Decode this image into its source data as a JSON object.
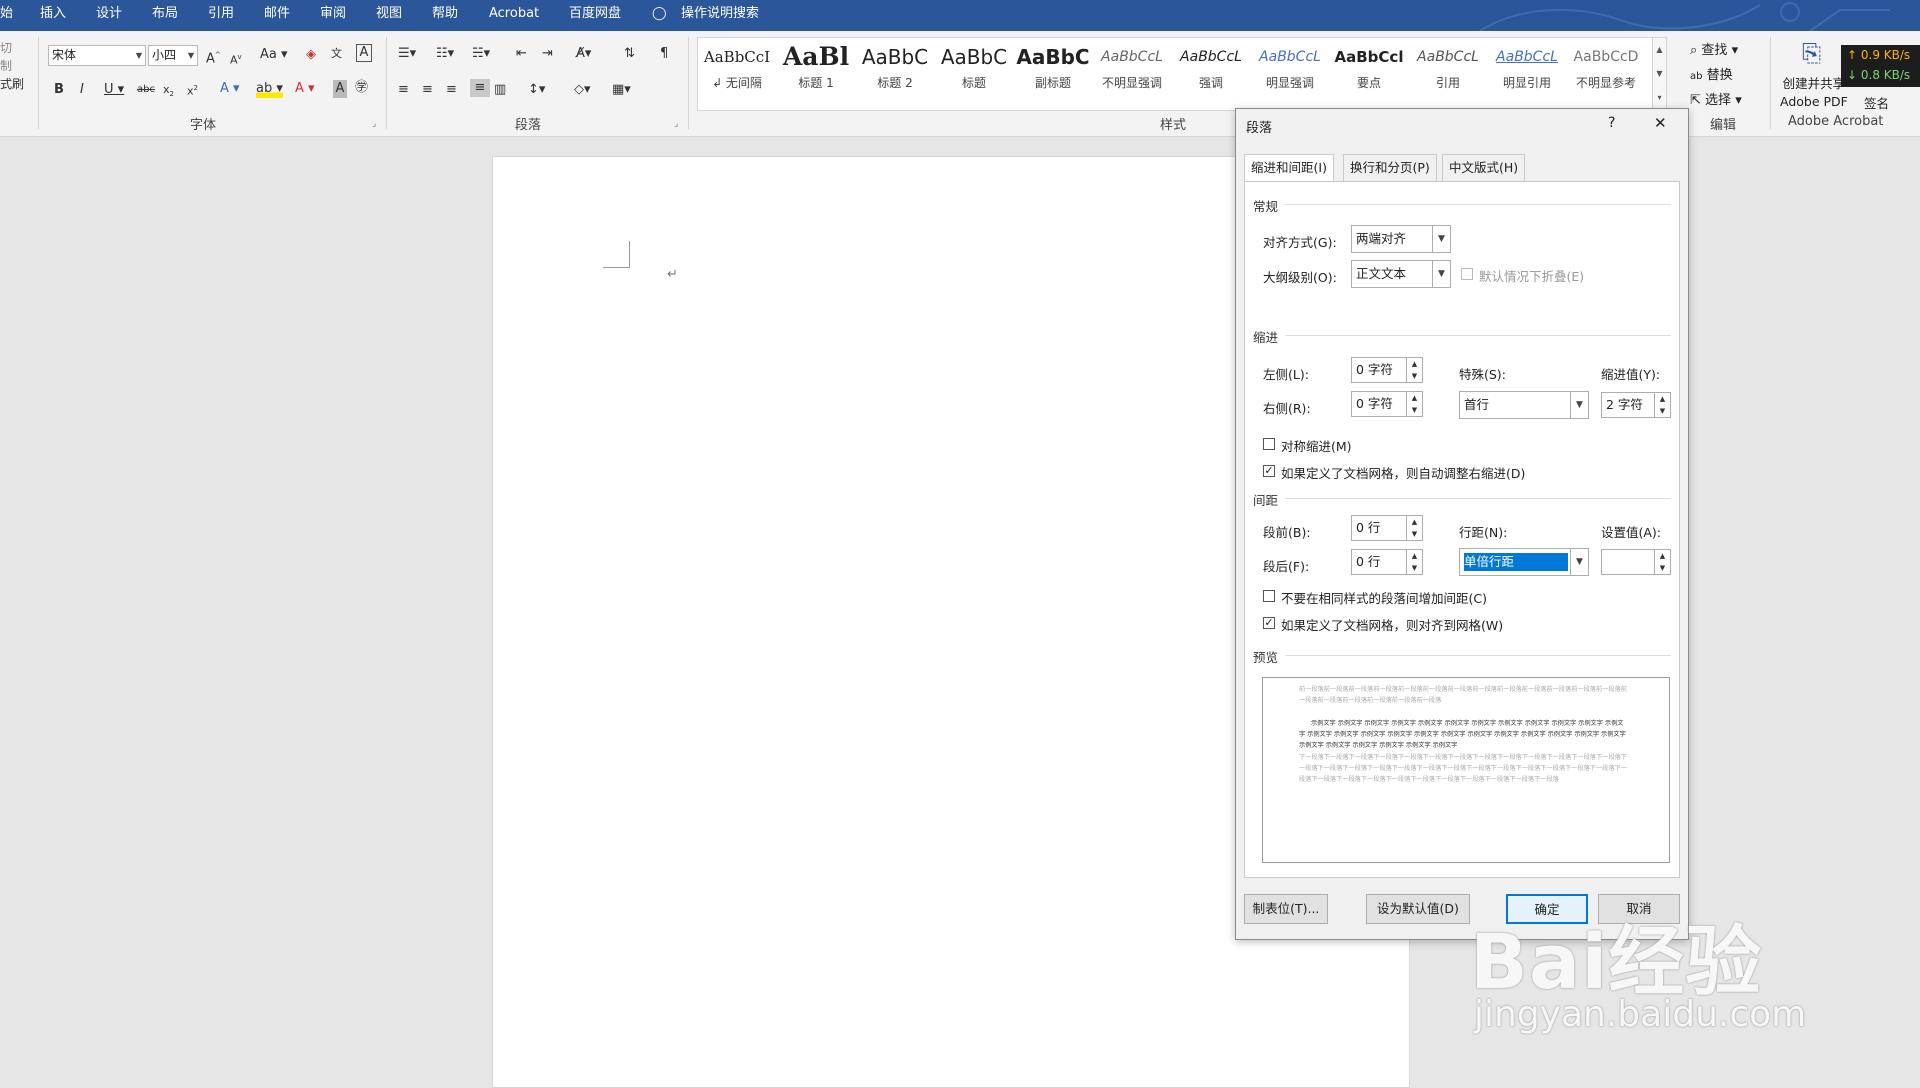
{
  "menu": {
    "items": [
      "插入",
      "设计",
      "布局",
      "引用",
      "邮件",
      "审阅",
      "视图",
      "帮助",
      "Acrobat",
      "百度网盘"
    ],
    "search_label": "操作说明搜索"
  },
  "clipboard_cut": {
    "lines": [
      "切",
      "制",
      "式刷"
    ]
  },
  "font": {
    "name": "宋体",
    "size": "小四",
    "group_label": "字体"
  },
  "paragraph_group": {
    "label": "段落"
  },
  "styles": {
    "group_label": "样式",
    "items": [
      {
        "preview": "AaBbCcI",
        "name": "↲ 无间隔"
      },
      {
        "preview": "AaBl",
        "name": "标题 1"
      },
      {
        "preview": "AaBbC",
        "name": "标题 2"
      },
      {
        "preview": "AaBbC",
        "name": "标题"
      },
      {
        "preview": "AaBbC",
        "name": "副标题"
      },
      {
        "preview": "AaBbCcL",
        "name": "不明显强调"
      },
      {
        "preview": "AaBbCcL",
        "name": "强调"
      },
      {
        "preview": "AaBbCcL",
        "name": "明显强调"
      },
      {
        "preview": "AaBbCcl",
        "name": "要点"
      },
      {
        "preview": "AaBbCcL",
        "name": "引用"
      },
      {
        "preview": "AaBbCcL",
        "name": "明显引用"
      },
      {
        "preview": "AaBbCcD",
        "name": "不明显参考"
      }
    ]
  },
  "editing": {
    "find": "查找",
    "replace": "替换",
    "select": "选择",
    "group_label": "编辑"
  },
  "acrobat": {
    "create_share": "创建并共享",
    "adobe_pdf": "Adobe PDF",
    "sign": "签名",
    "group_label": "Adobe Acrobat"
  },
  "network": {
    "up": "↑ 0.9 KB/s",
    "down": "↓ 0.8 KB/s"
  },
  "dialog": {
    "title": "段落",
    "help": "?",
    "close": "✕",
    "tabs": [
      "缩进和间距(I)",
      "换行和分页(P)",
      "中文版式(H)"
    ],
    "general": {
      "header": "常规",
      "alignment_label": "对齐方式(G):",
      "alignment_value": "两端对齐",
      "outline_label": "大纲级别(O):",
      "outline_value": "正文文本",
      "collapse_label": "默认情况下折叠(E)"
    },
    "indent": {
      "header": "缩进",
      "left_label": "左侧(L):",
      "left_value": "0 字符",
      "right_label": "右侧(R):",
      "right_value": "0 字符",
      "special_label": "特殊(S):",
      "special_value": "首行",
      "indent_by_label": "缩进值(Y):",
      "indent_by_value": "2 字符",
      "mirror_label": "对称缩进(M)",
      "mirror_checked": false,
      "auto_adjust_label": "如果定义了文档网格，则自动调整右缩进(D)",
      "auto_adjust_checked": true
    },
    "spacing": {
      "header": "间距",
      "before_label": "段前(B):",
      "before_value": "0 行",
      "after_label": "段后(F):",
      "after_value": "0 行",
      "line_spacing_label": "行距(N):",
      "line_spacing_value": "单倍行距",
      "at_label": "设置值(A):",
      "at_value": "",
      "no_space_label": "不要在相同样式的段落间增加间距(C)",
      "no_space_checked": false,
      "snap_grid_label": "如果定义了文档网格，则对齐到网格(W)",
      "snap_grid_checked": true
    },
    "preview": {
      "header": "预览",
      "prev_para": "前一段落前一段落前一段落前一段落前一段落前一段落前一段落前一段落前一段落前一段落前一段落前一段落前一段落前一段落前一段落前一段落前一段落前一段落前一段落",
      "sample": "示例文字 示例文字 示例文字 示例文字 示例文字 示例文字 示例文字 示例文字 示例文字 示例文字 示例文字 示例文字 示例文字 示例文字 示例文字 示例文字 示例文字 示例文字 示例文字 示例文字 示例文字 示例文字 示例文字 示例文字 示例文字 示例文字 示例文字 示例文字 示例文字 示例文字",
      "next_para": "下一段落下一段落下一段落下一段落下一段落下一段落下一段落下一段落下一段落下一段落下一段落下一段落下一段落下一段落下一段落下一段落下一段落下一段落下一段落下一段落下一段落下一段落下一段落下一段落下一段落下一段落下一段落下一段落下一段落下一段落下一段落下一段落下一段落下一段落下一段落下一段落下一段落"
    },
    "buttons": {
      "tabs": "制表位(T)...",
      "set_default": "设为默认值(D)",
      "ok": "确定",
      "cancel": "取消"
    }
  },
  "watermark": {
    "brand": "Bai经验",
    "url": "jingyan.baidu.com"
  }
}
